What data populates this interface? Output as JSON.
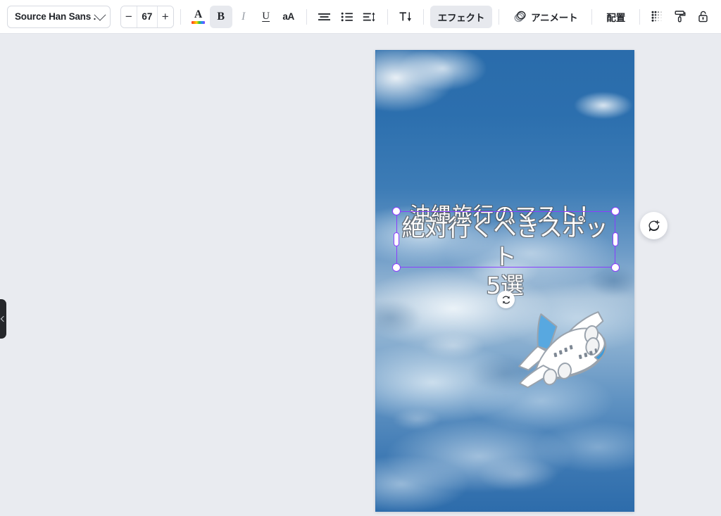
{
  "toolbar": {
    "font_family": {
      "value": "Source Han Sans ...",
      "icon": "chevron-down-icon"
    },
    "font_size": {
      "value": "67",
      "decrease": "−",
      "increase": "+"
    },
    "text_color": {
      "label": "A",
      "icon": "text-color-icon"
    },
    "bold": {
      "label": "B",
      "active": true
    },
    "italic": {
      "label": "I"
    },
    "underline": {
      "label": "U"
    },
    "letter_case": {
      "label": "aA"
    },
    "align": {
      "icon": "align-center-icon"
    },
    "list": {
      "icon": "bullet-list-icon"
    },
    "spacing": {
      "icon": "line-spacing-icon"
    },
    "vertical_text": {
      "label": "T↓",
      "icon": "vertical-text-icon"
    },
    "effects": {
      "label": "エフェクト",
      "active": true
    },
    "animate": {
      "label": "アニメート",
      "icon": "animate-icon"
    },
    "position": {
      "label": "配置"
    },
    "transparency": {
      "icon": "transparency-icon"
    },
    "copy_style": {
      "icon": "paint-roller-icon"
    },
    "lock": {
      "icon": "unlock-icon"
    }
  },
  "canvas": {
    "title_text": "沖縄旅行のマスト！",
    "subtitle_line1": "絶対行くべきスポット",
    "subtitle_line2": "5選",
    "sticker": "airplane-sticker",
    "background": "sky-clouds-photo"
  },
  "overlays": {
    "rotate_handle": "rotate-icon",
    "comment_button": "add-comment-icon",
    "left_panel_tab": "expand-panel-icon"
  },
  "colors": {
    "accent_selection": "#8b3dff",
    "toolbar_bg": "#ffffff",
    "workspace_bg": "#e9ebf0",
    "sky_blue": "#2a6cab"
  }
}
